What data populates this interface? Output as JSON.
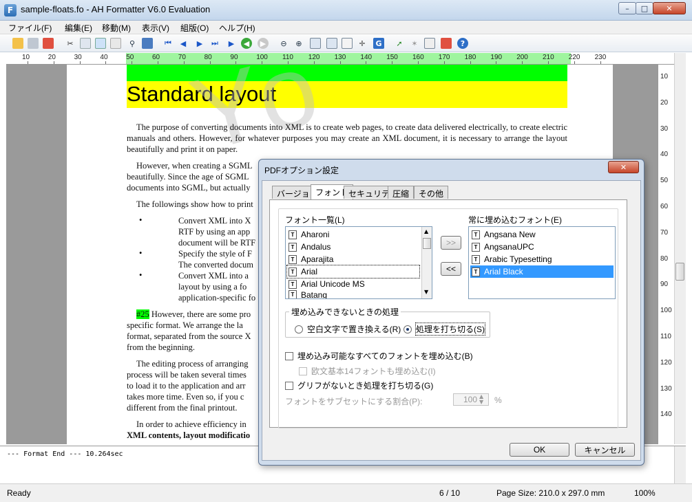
{
  "window": {
    "title": "sample-floats.fo - AH Formatter V6.0 Evaluation",
    "app_icon_glyph": "F",
    "minimize": "–",
    "maximize": "□",
    "close": "✕"
  },
  "menu": [
    "ファイル(F)",
    "編集(E)",
    "移動(M)",
    "表示(V)",
    "組版(O)",
    "ヘルプ(H)"
  ],
  "toolbar_icons": [
    "open-folder-icon",
    "print-icon",
    "pdf-icon",
    "cut-icon",
    "copy-icon",
    "edit-icon",
    "settings-doc-icon",
    "find-icon",
    "chart-icon",
    "first-page-icon",
    "prev-page-icon",
    "next-page-icon",
    "last-page-icon",
    "back-icon",
    "forward-icon",
    "zoom-out-icon",
    "zoom-in-icon",
    "fit-page-icon",
    "fit-width-icon",
    "page-view-icon",
    "crosshair-icon",
    "go-page-icon",
    "format-icon",
    "stop-icon",
    "export-icon",
    "option-icon",
    "help-icon"
  ],
  "ruler": {
    "labels": [
      "10",
      "20",
      "30",
      "40",
      "50",
      "60",
      "70",
      "80",
      "90",
      "100",
      "110",
      "120",
      "130",
      "140",
      "150",
      "160",
      "170",
      "180",
      "190",
      "200",
      "210",
      "220",
      "230"
    ],
    "vlabels": [
      "10",
      "20",
      "30",
      "40",
      "50",
      "60",
      "70",
      "80",
      "90",
      "100",
      "110",
      "120",
      "130",
      "140"
    ]
  },
  "document": {
    "heading": "Standard layout",
    "p1": "The purpose of converting documents into XML is to create web pages, to create data delivered electrically, to create electric manuals and others. However, for whatever purposes you may create an XML document, it is necessary to arrange the layout beautifully and print it on paper.",
    "p2a": "However, when creating a SGML",
    "p2b": "beautifully. Since the age of SGML",
    "p2c": "documents into SGML, but actually",
    "p3": "The followings show how to print",
    "b1a": "Convert XML into X",
    "b1b": "RTF by using an app",
    "b1c": "document will be RTF",
    "b2a": "Specify the style of F",
    "b2b": "The converted docum",
    "b3a": "Convert XML into a",
    "b3b": "layout by using a fo",
    "b3c": "application-specific fo",
    "bullet": "•",
    "tag25": "#25",
    "p4a": "However, there are some pro",
    "p4b": "specific format. We arrange the la",
    "p4c": "format, separated from the source X",
    "p4d": "from the beginning.",
    "p5a": "The editing process of arranging",
    "p5b": "process will be taken several times",
    "p5c": "to load it to the application and arr",
    "p5d": "takes more time. Even so, if you c",
    "p5e": "different from the final printout.",
    "p6a": "In order to achieve efficiency in",
    "p6b": "XML contents, layout modificatio",
    "watermark": "Yo"
  },
  "log": {
    "line": "--- Format End ---   10.264sec"
  },
  "status": {
    "ready": "Ready",
    "page": "6 / 10",
    "page_size": "Page Size: 210.0 x 297.0 mm",
    "zoom": "100%"
  },
  "dialog": {
    "title": "PDFオプション設定",
    "close": "✕",
    "tabs": [
      "バージョン",
      "フォント",
      "セキュリティ",
      "圧縮",
      "その他"
    ],
    "font_list_label": "フォント一覧(L)",
    "embed_list_label": "常に埋め込むフォント(E)",
    "font_list": [
      "Aharoni",
      "Andalus",
      "Aparajita",
      "Arial",
      "Arial Unicode MS",
      "Batang"
    ],
    "embed_list": [
      "Angsana New",
      "AngsanaUPC",
      "Arabic Typesetting",
      "Arial Black"
    ],
    "font_icon_glyph": "T",
    "add_btn": ">>",
    "remove_btn": "<<",
    "unembed_group": "埋め込みできないときの処理",
    "radio_replace": "空白文字で置き換える(R)",
    "radio_abort": "処理を打ち切る(S)",
    "chk_embed_all": "埋め込み可能なすべてのフォントを埋め込む(B)",
    "chk_base14": "欧文基本14フォントも埋め込む(I)",
    "chk_glyph": "グリフがないとき処理を打ち切る(G)",
    "subset_label": "フォントをサブセットにする割合(P):",
    "subset_value": "100",
    "subset_unit": "%",
    "ok": "OK",
    "cancel": "キャンセル"
  }
}
